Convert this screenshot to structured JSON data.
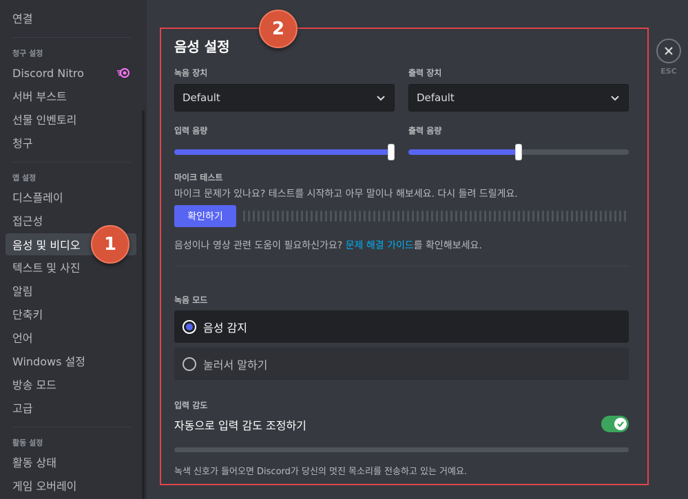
{
  "sidebar": {
    "connections": "연결",
    "billing_header": "청구 설정",
    "billing_items": [
      "Discord Nitro",
      "서버 부스트",
      "선물 인벤토리",
      "청구"
    ],
    "app_header": "앱 설정",
    "app_items": [
      "디스플레이",
      "접근성",
      "음성 및 비디오",
      "텍스트 및 사진",
      "알림",
      "단축키",
      "언어",
      "Windows 설정",
      "방송 모드",
      "고급"
    ],
    "active_item": "음성 및 비디오",
    "activity_header": "활동 설정",
    "activity_items": [
      "활동 상태",
      "게임 오버레이"
    ]
  },
  "badges": {
    "first": "1",
    "second": "2"
  },
  "voice": {
    "title": "음성 설정",
    "input_device_label": "녹음 장치",
    "input_device_value": "Default",
    "output_device_label": "출력 장치",
    "output_device_value": "Default",
    "input_volume_label": "입력 음량",
    "input_volume": 1.0,
    "output_volume_label": "출력 음량",
    "output_volume": 0.5
  },
  "mic_test": {
    "label": "마이크 테스트",
    "description": "마이크 문제가 있나요? 테스트를 시작하고 아무 말이나 해보세요. 다시 들려 드릴게요.",
    "button": "확인하기",
    "help_prefix": "음성이나 영상 관련 도움이 필요하신가요? ",
    "help_link": "문제 해결 가이드",
    "help_suffix": "를 확인해보세요."
  },
  "input_mode": {
    "label": "녹음 모드",
    "options": [
      "음성 감지",
      "눌러서 말하기"
    ],
    "selected": "음성 감지"
  },
  "sensitivity": {
    "label": "입력 감도",
    "auto_label": "자동으로 입력 감도 조정하기",
    "auto_enabled": true,
    "hint": "녹색 신호가 들어오면 Discord가 당신의 멋진 목소리를 전송하고 있는 거예요."
  },
  "close": {
    "esc_label": "ESC"
  },
  "colors": {
    "accent": "#5865f2",
    "toggle_on": "#3ba55d",
    "link": "#00aff4",
    "highlight_frame": "#e0444a",
    "badge": "#d8553a"
  },
  "icons": {
    "nitro": "nitro-icon",
    "chevron": "chevron-down-icon",
    "close": "close-icon",
    "check": "check-icon"
  }
}
